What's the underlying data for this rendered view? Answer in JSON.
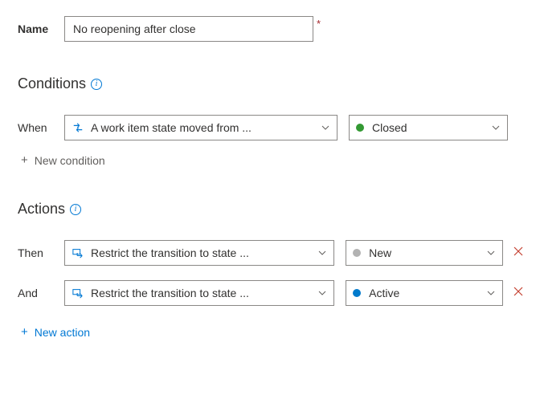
{
  "name": {
    "label": "Name",
    "value": "No reopening after close"
  },
  "conditions": {
    "heading": "Conditions",
    "when_label": "When",
    "rows": [
      {
        "rule": "A work item state moved from ...",
        "state": "Closed",
        "dot": "dot-closed"
      }
    ],
    "add_label": "New condition"
  },
  "actions": {
    "heading": "Actions",
    "then_label": "Then",
    "and_label": "And",
    "rows": [
      {
        "rule": "Restrict the transition to state ...",
        "state": "New",
        "dot": "dot-new"
      },
      {
        "rule": "Restrict the transition to state ...",
        "state": "Active",
        "dot": "dot-active"
      }
    ],
    "add_label": "New action"
  }
}
